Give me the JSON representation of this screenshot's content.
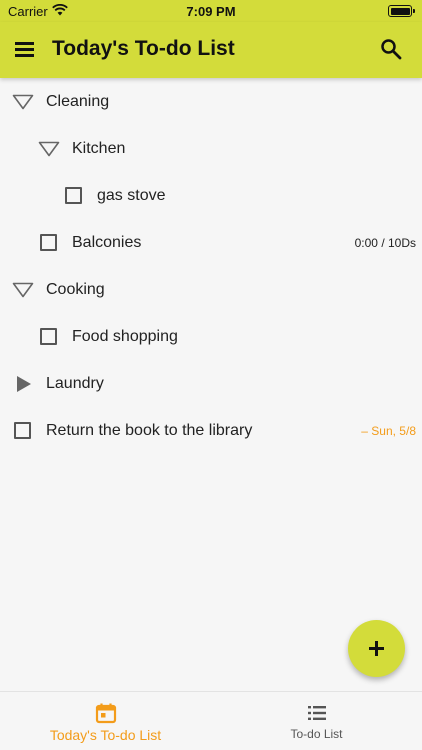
{
  "status_bar": {
    "carrier": "Carrier",
    "time": "7:09 PM"
  },
  "app_bar": {
    "title": "Today's To-do List",
    "background_color": "#d3dc3a",
    "menu_icon": "menu-icon",
    "search_icon": "search-icon"
  },
  "tasks": [
    {
      "label": "Cleaning",
      "kind": "group",
      "expanded": true,
      "level": 0,
      "meta": ""
    },
    {
      "label": "Kitchen",
      "kind": "group",
      "expanded": true,
      "level": 1,
      "meta": ""
    },
    {
      "label": "gas stove",
      "kind": "task",
      "checked": false,
      "level": 2,
      "meta": ""
    },
    {
      "label": "Balconies",
      "kind": "task",
      "checked": false,
      "level": 1,
      "meta": "0:00 / 10Ds"
    },
    {
      "label": "Cooking",
      "kind": "group",
      "expanded": true,
      "level": 0,
      "meta": ""
    },
    {
      "label": "Food shopping",
      "kind": "task",
      "checked": false,
      "level": 1,
      "meta": ""
    },
    {
      "label": "Laundry",
      "kind": "group",
      "expanded": false,
      "level": 0,
      "meta": ""
    },
    {
      "label": "Return the book to the library",
      "kind": "task",
      "checked": false,
      "level": 0,
      "meta": "– Sun, 5/8"
    }
  ],
  "accent_color": "#f39c1a",
  "fab": {
    "icon": "plus-icon"
  },
  "bottom_nav": {
    "items": [
      {
        "label": "Today's To-do List",
        "icon": "calendar-icon",
        "active": true
      },
      {
        "label": "To-do List",
        "icon": "list-icon",
        "active": false
      }
    ]
  }
}
